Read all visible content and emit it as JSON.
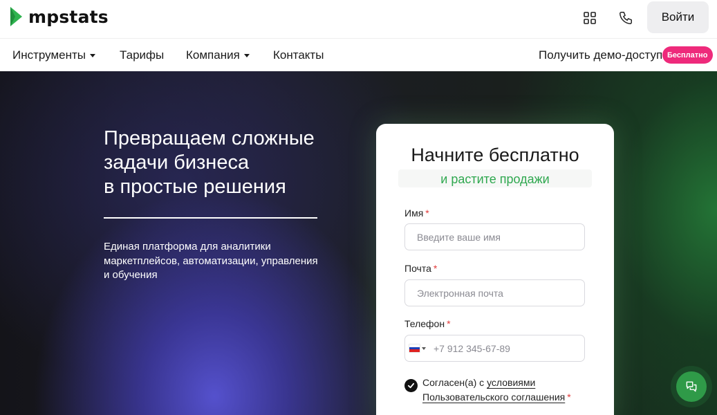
{
  "header": {
    "logo_text": "mpstats",
    "login_label": "Войти"
  },
  "nav": {
    "items": [
      {
        "label": "Инструменты",
        "has_dropdown": true
      },
      {
        "label": "Тарифы",
        "has_dropdown": false
      },
      {
        "label": "Компания",
        "has_dropdown": true
      },
      {
        "label": "Контакты",
        "has_dropdown": false
      }
    ],
    "demo_label": "Получить демо-доступ",
    "free_badge": "Бесплатно"
  },
  "hero": {
    "title_lines": [
      "Превращаем сложные",
      "задачи бизнеса",
      "в простые решения"
    ],
    "subtitle": "Единая платформа для аналитики маркетплейсов, автоматизации, управления и обучения"
  },
  "form": {
    "title": "Начните бесплатно",
    "subtitle": "и растите продажи",
    "name_label": "Имя",
    "name_placeholder": "Введите ваше имя",
    "email_label": "Почта",
    "email_placeholder": "Электронная почта",
    "phone_label": "Телефон",
    "phone_placeholder": "+7 912 345-67-89",
    "required_mark": "*",
    "agree_prefix": "Согласен(а) с",
    "agree_link": "условиями Пользовательского соглашения",
    "agree_checked": true
  },
  "colors": {
    "brand_green": "#2fa84f",
    "badge_pink": "#ee2a7b",
    "required_red": "#e23a3a"
  }
}
